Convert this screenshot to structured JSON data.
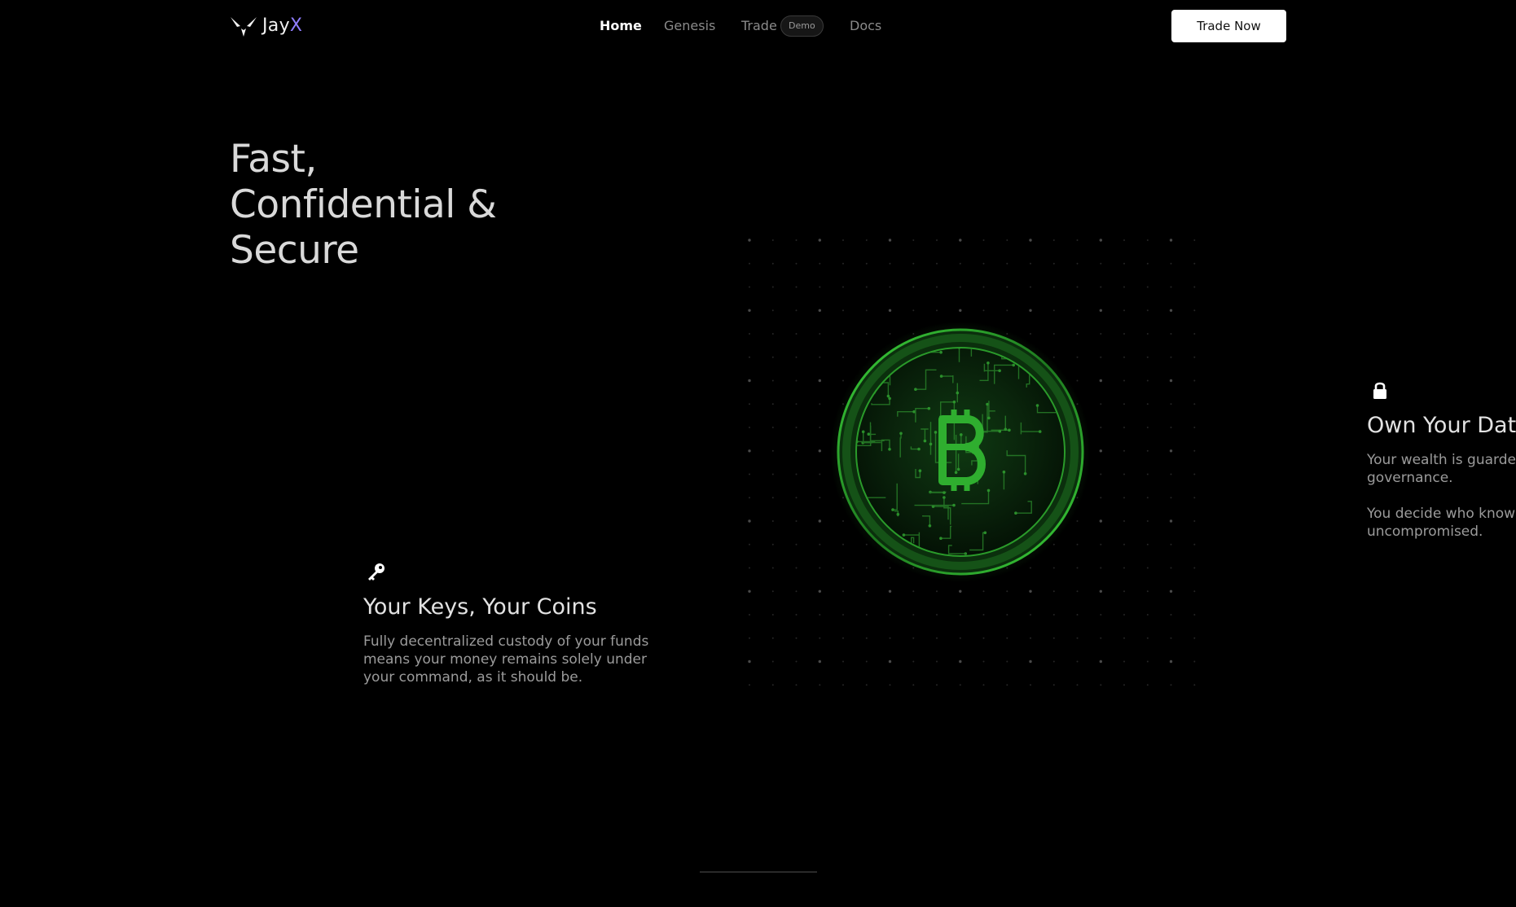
{
  "nav": {
    "logo": {
      "text_main": "Jay",
      "text_accent": "X",
      "accent_color": "#8f7dff"
    },
    "links": {
      "home": "Home",
      "genesis": "Genesis",
      "trade": "Trade",
      "trade_badge": "Demo",
      "docs": "Docs"
    },
    "active_link": "home",
    "cta": "Trade Now"
  },
  "hero": {
    "title_lines": [
      "Fast,",
      "Confidential &",
      "Secure"
    ]
  },
  "visual": {
    "coin_glow_color": "#2ea82a",
    "coin_symbol": "bitcoin-symbol"
  },
  "features": {
    "keys": {
      "icon": "key-icon",
      "title": "Your Keys, Your Coins",
      "text": "Fully decentralized custody of your funds means your money remains solely under your command, as it should be."
    },
    "data": {
      "icon": "lock-icon",
      "title": "Own Your Data",
      "text_1": "Your wealth is guarded by unbreakable privacy and self-governance.",
      "text_2": "You decide who knows what: total autonomy, uncompromised."
    }
  },
  "carousel": {
    "progress": 0
  }
}
